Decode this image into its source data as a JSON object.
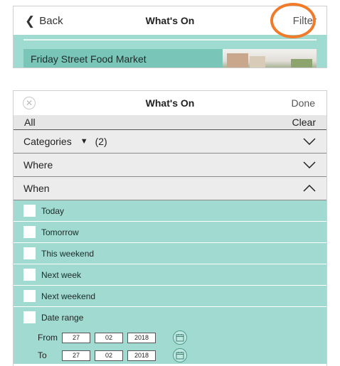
{
  "top": {
    "back_label": "Back",
    "title": "What's On",
    "filter_label": "Filter",
    "event": "Friday Street Food Market"
  },
  "filter": {
    "title": "What's On",
    "done_label": "Done",
    "all_label": "All",
    "clear_label": "Clear",
    "sections": {
      "categories": {
        "label": "Categories",
        "count": "(2)"
      },
      "where": {
        "label": "Where"
      },
      "when": {
        "label": "When"
      }
    },
    "options": [
      "Today",
      "Tomorrow",
      "This weekend",
      "Next week",
      "Next weekend"
    ],
    "date_range": {
      "label": "Date range",
      "from": {
        "label": "From",
        "day": "27",
        "month": "02",
        "year": "2018"
      },
      "to": {
        "label": "To",
        "day": "27",
        "month": "02",
        "year": "2018"
      }
    }
  },
  "colors": {
    "accent": "#a1dad1",
    "highlight": "#ef7b2b"
  }
}
